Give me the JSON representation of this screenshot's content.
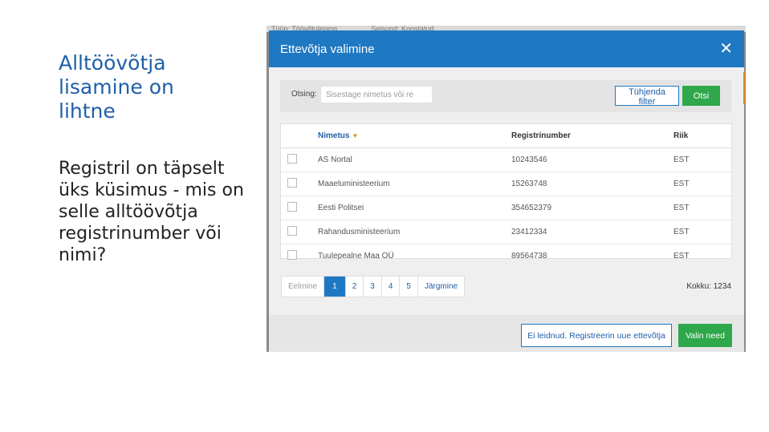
{
  "slide": {
    "title": "Alltöövõtja\nlisamine on\nlihtne",
    "body": "Registril on täpselt\nüks küsimus - mis on\nselle alltöövõtja\nregistrinumber või\nnimi?"
  },
  "background_strip": {
    "left_text": "Tüüp: Töövõtuleping",
    "right_text": "Seisund: Koostatud"
  },
  "modal": {
    "title": "Ettevõtja valimine",
    "close_icon": "close-icon",
    "search": {
      "label": "Otsing:",
      "placeholder": "Sisestage nimetus või re",
      "clear_label": "Tühjenda filter",
      "search_label": "Otsi"
    },
    "table": {
      "columns": [
        "Nimetus",
        "Registrinumber",
        "Riik"
      ],
      "sorted_column": "Nimetus",
      "rows": [
        {
          "name": "AS Nortal",
          "reg": "10243546",
          "country": "EST"
        },
        {
          "name": "Maaeluministeerium",
          "reg": "15263748",
          "country": "EST"
        },
        {
          "name": "Eesti Politsei",
          "reg": "354652379",
          "country": "EST"
        },
        {
          "name": "Rahandusministeerium",
          "reg": "23412334",
          "country": "EST"
        },
        {
          "name": "Tuulepealne Maa OÜ",
          "reg": "89564738",
          "country": "EST"
        }
      ]
    },
    "pagination": {
      "prev": "Eelmine",
      "pages": [
        "1",
        "2",
        "3",
        "4",
        "5"
      ],
      "active_page": "1",
      "next": "Järgmine",
      "total": "Kokku: 1234"
    },
    "footer": {
      "register_label": "Ei leidnud. Registreerin uue ettevõtja",
      "select_label": "Valin need"
    }
  },
  "colors": {
    "header_blue": "#1f78c2",
    "title_blue": "#1f5fa8",
    "green": "#2ea84a",
    "sort_orange": "#e08a17"
  }
}
